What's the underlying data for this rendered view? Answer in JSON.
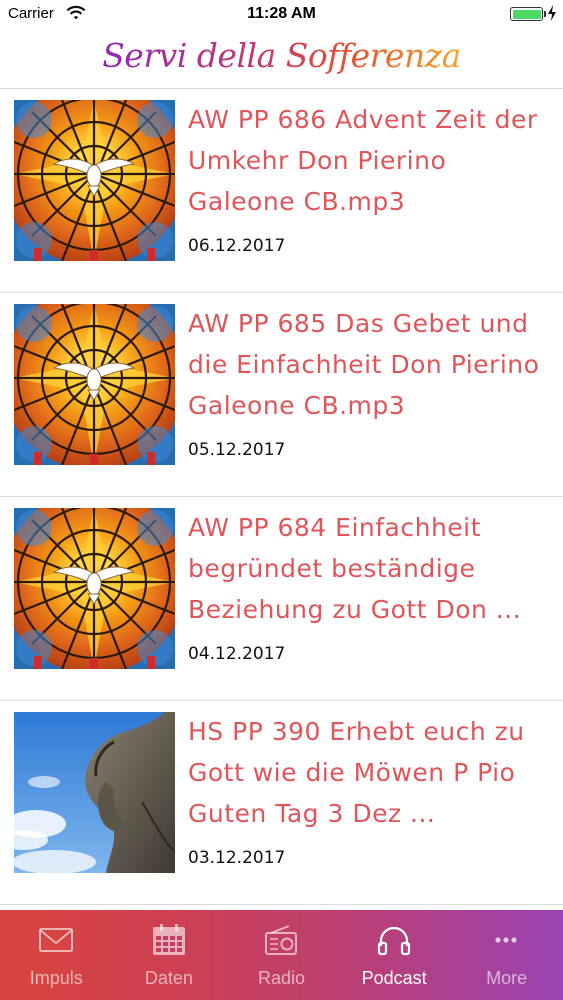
{
  "status_bar": {
    "carrier": "Carrier",
    "time": "11:28 AM",
    "battery_color": "#4cd964"
  },
  "header": {
    "title": "Servi della Sofferenza"
  },
  "podcasts": [
    {
      "title": "AW PP 686 Advent Zeit der Umkehr Don Pierino Galeone CB.mp3",
      "date": "06.12.2017",
      "thumbnail": "stained-glass-dove"
    },
    {
      "title": "AW PP 685 Das Gebet und die Einfachheit Don Pierino Galeone CB.mp3",
      "date": "05.12.2017",
      "thumbnail": "stained-glass-dove"
    },
    {
      "title": "AW PP 684 Einfachheit begründet beständige Beziehung zu Gott Don ...",
      "date": "04.12.2017",
      "thumbnail": "stained-glass-dove"
    },
    {
      "title": "HS PP 390 Erhebt euch zu Gott wie die Möwen P Pio Guten Tag 3 Dez ...",
      "date": "03.12.2017",
      "thumbnail": "padre-pio-statue"
    }
  ],
  "tab_bar": {
    "tabs": [
      {
        "label": "Impuls",
        "icon": "envelope-icon",
        "active": false
      },
      {
        "label": "Daten",
        "icon": "calendar-icon",
        "active": false
      },
      {
        "label": "Radio",
        "icon": "radio-icon",
        "active": false
      },
      {
        "label": "Podcast",
        "icon": "headphones-icon",
        "active": true
      },
      {
        "label": "More",
        "icon": "more-icon",
        "active": false
      }
    ]
  },
  "colors": {
    "title_text": "#e0555a",
    "tab_gradient_start": "#d9453f",
    "tab_gradient_end": "#9a44b3"
  }
}
